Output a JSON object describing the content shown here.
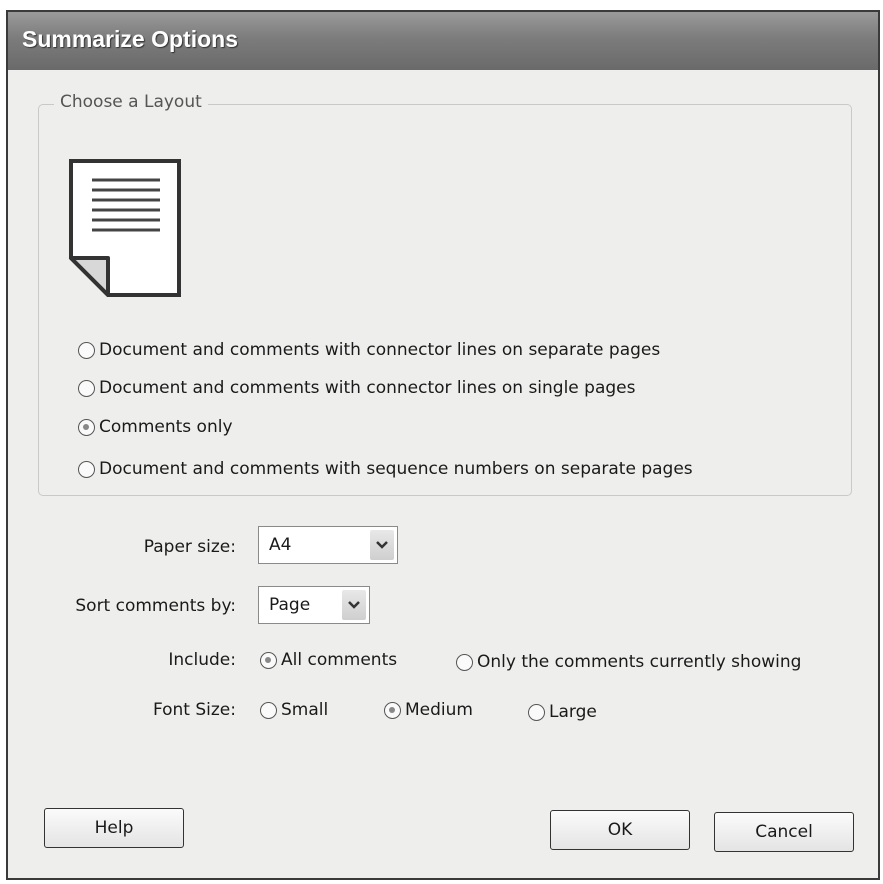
{
  "window": {
    "title": "Summarize Options"
  },
  "layout_group": {
    "legend": "Choose a Layout",
    "icon": "document-page-icon",
    "options": [
      {
        "label": "Document and comments with connector lines on separate pages",
        "checked": false
      },
      {
        "label": "Document and comments with connector lines on single pages",
        "checked": false
      },
      {
        "label": "Comments only",
        "checked": true
      },
      {
        "label": "Document and comments with sequence numbers on separate pages",
        "checked": false
      }
    ]
  },
  "paper_size": {
    "label": "Paper size:",
    "value": "A4"
  },
  "sort_by": {
    "label": "Sort comments by:",
    "value": "Page"
  },
  "include": {
    "label": "Include:",
    "options": [
      {
        "label": "All comments",
        "checked": true
      },
      {
        "label": "Only the comments currently showing",
        "checked": false
      }
    ]
  },
  "font_size": {
    "label": "Font Size:",
    "options": [
      {
        "label": "Small",
        "checked": false
      },
      {
        "label": "Medium",
        "checked": true
      },
      {
        "label": "Large",
        "checked": false
      }
    ]
  },
  "buttons": {
    "help": "Help",
    "ok": "OK",
    "cancel": "Cancel"
  }
}
